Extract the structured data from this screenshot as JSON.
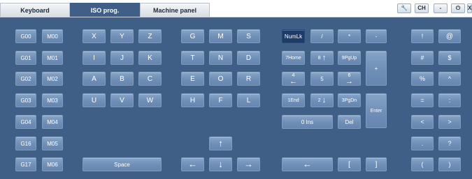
{
  "tabs": [
    "Keyboard",
    "ISO prog.",
    "Machine panel"
  ],
  "toolbar": {
    "wrench": "🔧",
    "ch": "CH",
    "minimize": "-",
    "power": "⏻",
    "close": "X"
  },
  "gcodes": [
    "G00",
    "G01",
    "G02",
    "G03",
    "G04",
    "G16",
    "G17"
  ],
  "mcodes": [
    "M00",
    "M01",
    "M02",
    "M03",
    "M04",
    "M05",
    "M06"
  ],
  "letters": [
    "X",
    "Y",
    "Z",
    "I",
    "J",
    "K",
    "A",
    "B",
    "C",
    "U",
    "V",
    "W"
  ],
  "letters2": [
    "G",
    "M",
    "S",
    "T",
    "N",
    "D",
    "E",
    "O",
    "R",
    "H",
    "F",
    "L"
  ],
  "space": "Space",
  "arrows": {
    "up": "↑",
    "down": "↓",
    "left": "←",
    "right": "→"
  },
  "numpad": {
    "numlk": "NumLk",
    "slash": "/",
    "star": "*",
    "minus": "-",
    "home": "7Home",
    "n8": "8",
    "pgup": "9PgUp",
    "plus": "+",
    "n4": "4",
    "n5": "5",
    "n6": "6",
    "end": "1End",
    "n2": "2",
    "pgdn": "3PgDn",
    "enter": "Enter",
    "ins": "0 Ins",
    "del": "Del",
    "backspace": "←",
    "lbracket": "[",
    "rbracket": "]"
  },
  "symbols": [
    "!",
    "@",
    "#",
    "$",
    "%",
    "^",
    "=",
    ":",
    "<",
    ">",
    ".",
    "?",
    "(",
    ")"
  ]
}
